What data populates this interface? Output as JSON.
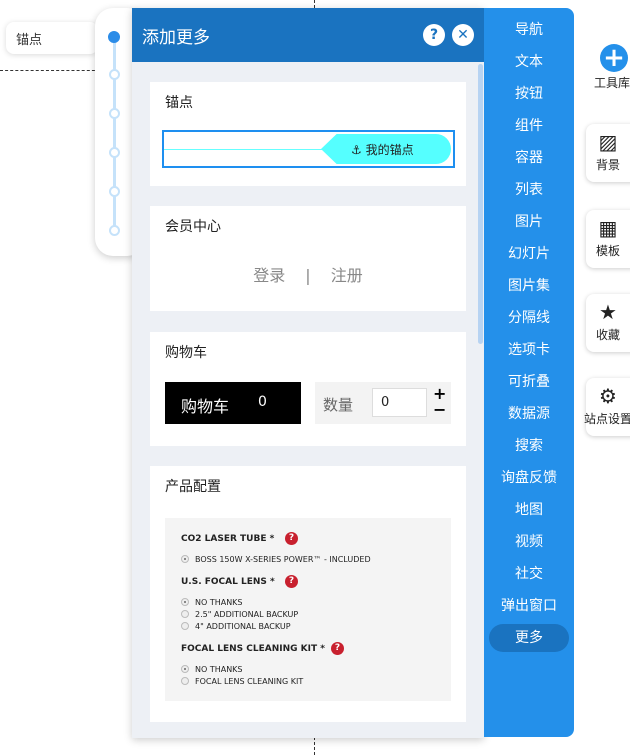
{
  "anchor_tag": "锚点",
  "panel": {
    "title": "添加更多",
    "help": "?",
    "close": "✕"
  },
  "cards": {
    "anchor": {
      "title": "锚点",
      "pill": "我的锚点"
    },
    "member": {
      "title": "会员中心",
      "login": "登录",
      "sep": "|",
      "register": "注册"
    },
    "cart": {
      "title": "购物车",
      "button": "购物车",
      "count": "0",
      "qty_label": "数量",
      "qty_value": "0",
      "plus": "+",
      "minus": "−"
    },
    "product": {
      "title": "产品配置",
      "groups": [
        {
          "name": "CO2 LASER TUBE *",
          "options": [
            "BOSS 150W X-SERIES POWER™ - INCLUDED"
          ]
        },
        {
          "name": "U.S. FOCAL LENS *",
          "options": [
            "NO THANKS",
            "2.5\" ADDITIONAL BACKUP",
            "4\" ADDITIONAL BACKUP"
          ]
        },
        {
          "name": "FOCAL LENS CLEANING KIT *",
          "options": [
            "NO THANKS",
            "FOCAL LENS CLEANING KIT"
          ]
        }
      ]
    }
  },
  "nav": [
    "导航",
    "文本",
    "按钮",
    "组件",
    "容器",
    "列表",
    "图片",
    "幻灯片",
    "图片集",
    "分隔线",
    "选项卡",
    "可折叠",
    "数据源",
    "搜索",
    "询盘反馈",
    "地图",
    "视频",
    "社交",
    "弹出窗口",
    "更多"
  ],
  "toolbox": "工具库",
  "side": [
    "背景",
    "模板",
    "收藏",
    "站点设置"
  ]
}
